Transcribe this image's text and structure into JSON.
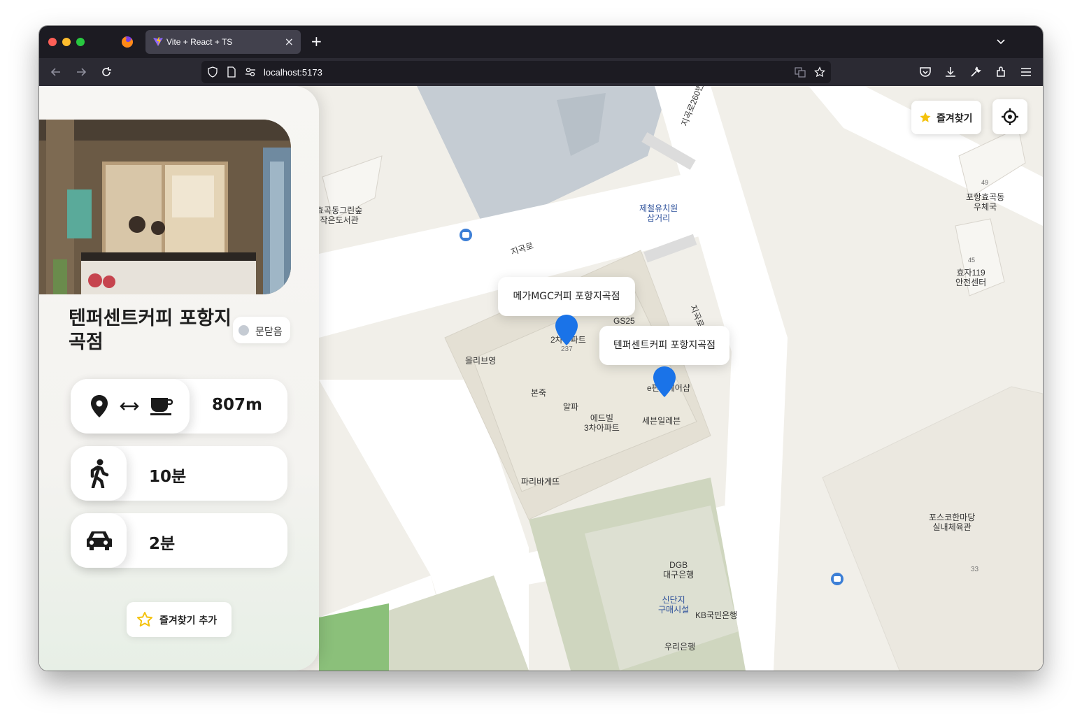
{
  "browser": {
    "tab_title": "Vite + React + TS",
    "url": "localhost:5173",
    "tab_close": "×",
    "new_tab": "+"
  },
  "panel": {
    "store_name": "텐퍼센트커피 포항지곡점",
    "status": "문닫음",
    "distance": "807m",
    "walk_time": "10분",
    "drive_time": "2분",
    "favorite_add_label": "즐겨찾기 추가"
  },
  "controls": {
    "favorites_label": "즐겨찾기"
  },
  "markers": [
    {
      "name": "메가MGC커피 포항지곡점"
    },
    {
      "name": "텐퍼센트커피 포항지곡점"
    }
  ],
  "map_labels": {
    "library": "효곡동그린숲\n작은도서관",
    "jigok_ro": "지곡로",
    "jigok_ro_260": "지곡로260번",
    "jigok_ro_side": "지곡로",
    "steel_kindergarten": "제철유치원\n삼거리",
    "post_office": "포항효곡동\n우체국",
    "safety_center": "효자119\n안전센터",
    "gs25": "GS25",
    "apt_2": "2차아파트",
    "apt_237": "237",
    "olive_young": "올리브영",
    "bonjuk": "본죽",
    "alpa": "알파",
    "edvill": "에드빌\n3차아파트",
    "seven_eleven": "세븐일레븐",
    "e_shop": "e편한헤어샵",
    "paris": "파리바게뜨",
    "dgb": "DGB\n대구은행",
    "sindanji": "신단지\n구매시설",
    "kb": "KB국민은행",
    "woori": "우리은행",
    "posco_gym": "포스코한마당\n실내체육관",
    "num_33": "33",
    "num_49": "49",
    "num_45": "45"
  },
  "colors": {
    "marker_blue": "#1a73e8",
    "status_dot": "#c5cbd3",
    "star_yellow": "#f4c20d",
    "bus_blue": "#3d7fd6"
  }
}
